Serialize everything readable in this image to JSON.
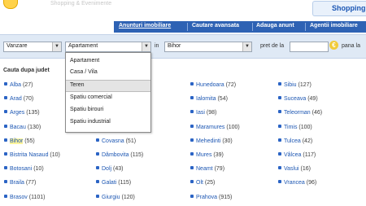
{
  "top": {
    "faded_text": "Shopping & Evenimente",
    "shopping_label": "Shopping"
  },
  "nav": {
    "items": [
      "Anunturi imobiliare",
      "Cautare avansata",
      "Adauga anunt",
      "Agentii imobiliare"
    ]
  },
  "search": {
    "transaction_value": "Vanzare",
    "property_value": "Apartament",
    "in_label": "in",
    "county_value": "Bihor",
    "price_from_label": "pret de la",
    "price_value": "",
    "currency_icon": "euro-coin-icon",
    "price_to_label": "pana la"
  },
  "dropdown": {
    "options": [
      "Apartament",
      "Casa / Vila",
      "Teren",
      "Spatiu comercial",
      "Spatiu birouri",
      "Spatiu industrial"
    ],
    "highlighted": "Teren"
  },
  "content": {
    "heading": "Cauta dupa judet",
    "columns": [
      [
        {
          "name": "Alba",
          "count": "(27)"
        },
        {
          "name": "Arad",
          "count": "(70)"
        },
        {
          "name": "Arges",
          "count": "(135)"
        },
        {
          "name": "Bacau",
          "count": "(130)"
        },
        {
          "name": "Bihor",
          "count": "(55)"
        },
        {
          "name": "Bistrita Nasaud",
          "count": "(10)"
        },
        {
          "name": "Botosani",
          "count": "(10)"
        },
        {
          "name": "Braila",
          "count": "(77)"
        },
        {
          "name": "Brasov",
          "count": "(1101)"
        }
      ],
      [
        {
          "name": "",
          "count": "(9)"
        },
        {
          "name": "",
          "count": "(19)"
        },
        {
          "name": "",
          "count": "(2)"
        },
        {
          "name": "",
          "count": "(82)"
        },
        {
          "name": "Covasna",
          "count": "(51)"
        },
        {
          "name": "Dâmbovita",
          "count": "(115)"
        },
        {
          "name": "Dolj",
          "count": "(43)"
        },
        {
          "name": "Galati",
          "count": "(115)"
        },
        {
          "name": "Giurgiu",
          "count": "(120)"
        }
      ],
      [
        {
          "name": "Hunedoara",
          "count": "(72)"
        },
        {
          "name": "Ialomita",
          "count": "(54)"
        },
        {
          "name": "Iasi",
          "count": "(98)"
        },
        {
          "name": "Maramures",
          "count": "(100)"
        },
        {
          "name": "Mehedinti",
          "count": "(30)"
        },
        {
          "name": "Mures",
          "count": "(39)"
        },
        {
          "name": "Neamt",
          "count": "(79)"
        },
        {
          "name": "Olt",
          "count": "(25)"
        },
        {
          "name": "Prahova",
          "count": "(915)"
        }
      ],
      [
        {
          "name": "Sibiu",
          "count": "(127)"
        },
        {
          "name": "Suceava",
          "count": "(49)"
        },
        {
          "name": "Teleorman",
          "count": "(46)"
        },
        {
          "name": "Timis",
          "count": "(100)"
        },
        {
          "name": "Tulcea",
          "count": "(42)"
        },
        {
          "name": "Vâlcea",
          "count": "(117)"
        },
        {
          "name": "Vaslui",
          "count": "(16)"
        },
        {
          "name": "Vrancea",
          "count": "(96)"
        }
      ]
    ]
  },
  "colors": {
    "nav_blue": "#2e62b4",
    "link_blue": "#1d57b3",
    "search_bg": "#dfe9f5",
    "highlight": "#fff49b"
  }
}
